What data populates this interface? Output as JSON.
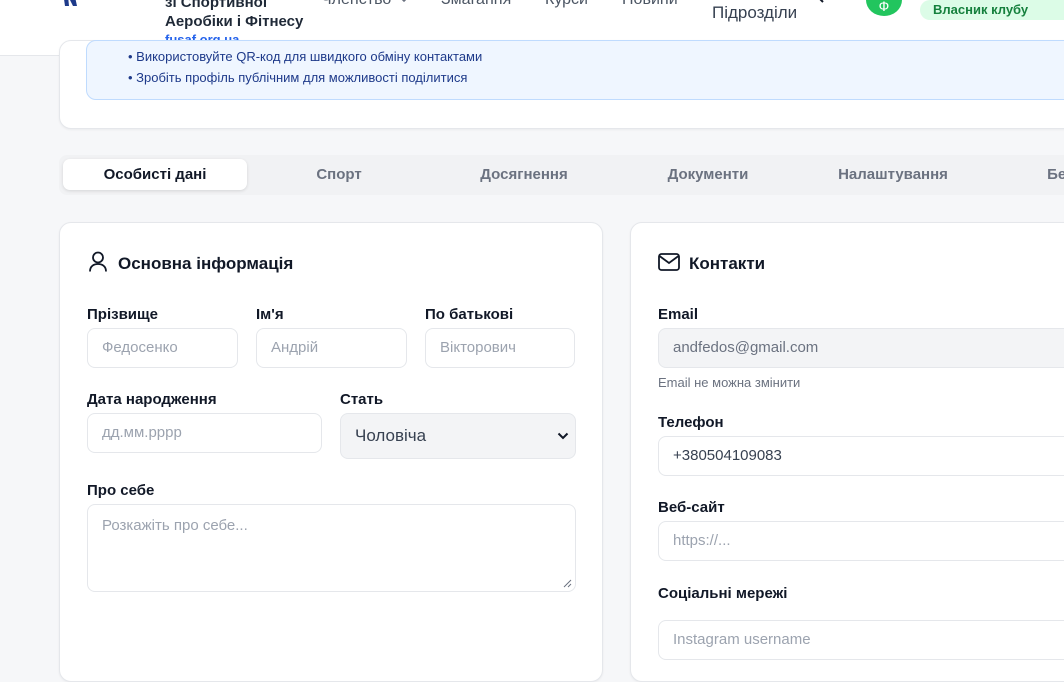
{
  "header": {
    "org_line1": "зі Спортивної",
    "org_line2": "Аеробіки і Фітнесу",
    "org_url": "fusaf.org.ua",
    "nav": [
      "Членство",
      "Змагання",
      "Курси",
      "Новини"
    ],
    "nav_sub": "Підрозділи",
    "role_badge": "Власник клубу",
    "avatar_initial": "Ф"
  },
  "tips": [
    "• Використовуйте QR-код для швидкого обміну контактами",
    "• Зробіть профіль публічним для можливості поділитися"
  ],
  "tabs": [
    "Особисті дані",
    "Спорт",
    "Досягнення",
    "Документи",
    "Налаштування",
    "Безпека"
  ],
  "basic": {
    "title": "Основна інформація",
    "surname_label": "Прізвище",
    "surname_placeholder": "Федосенко",
    "name_label": "Ім'я",
    "name_placeholder": "Андрій",
    "patronymic_label": "По батькові",
    "patronymic_placeholder": "Вікторович",
    "birth_label": "Дата народження",
    "birth_placeholder": "дд.мм.рррр",
    "gender_label": "Стать",
    "gender_value": "Чоловіча",
    "about_label": "Про себе",
    "about_placeholder": "Розкажіть про себе..."
  },
  "contacts": {
    "title": "Контакти",
    "email_label": "Email",
    "email_value": "andfedos@gmail.com",
    "email_hint": "Email не можна змінити",
    "phone_label": "Телефон",
    "phone_value": "+380504109083",
    "website_label": "Веб-сайт",
    "website_placeholder": "https://...",
    "social_label": "Соціальні мережі",
    "instagram_placeholder": "Instagram username"
  },
  "colors": {
    "accent": "#2563eb",
    "badge_bg": "#dcfce7",
    "badge_text": "#15803d",
    "tips_bg": "#eff6ff"
  }
}
